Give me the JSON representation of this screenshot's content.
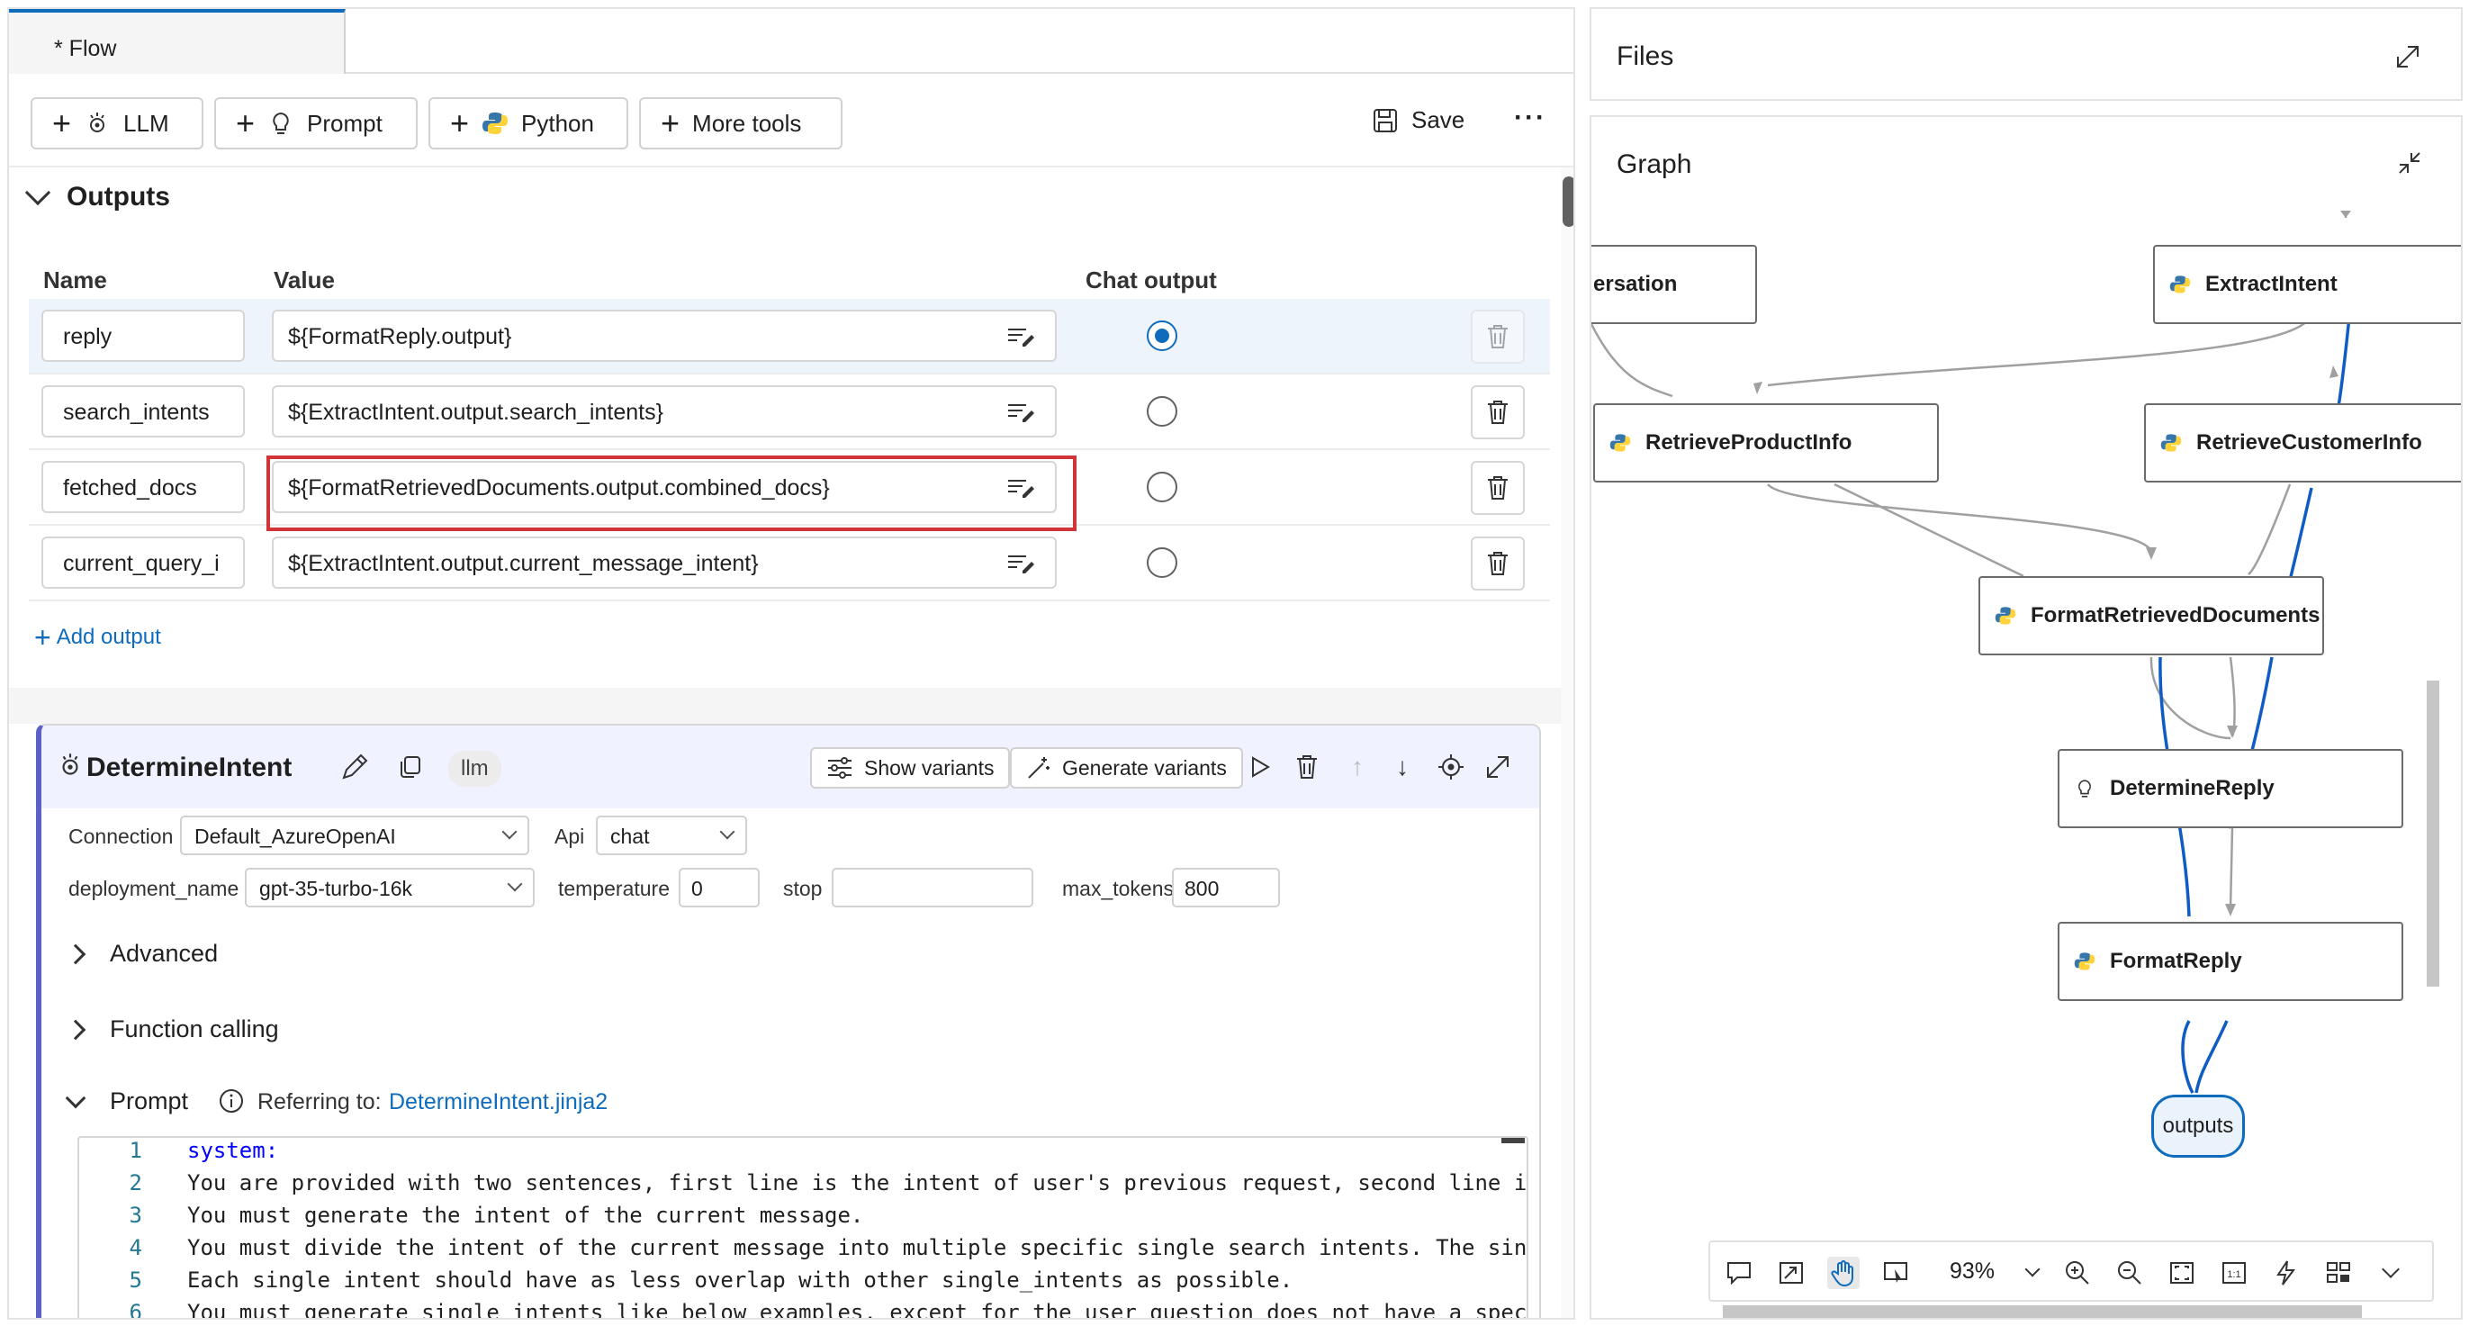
{
  "tab": {
    "label": "* Flow"
  },
  "toolbar": {
    "llm_label": "LLM",
    "prompt_label": "Prompt",
    "python_label": "Python",
    "more_tools_label": "More tools",
    "save_label": "Save",
    "more_label": "···"
  },
  "outputs": {
    "header": "Outputs",
    "columns": {
      "name": "Name",
      "value": "Value",
      "chat": "Chat output"
    },
    "rows": [
      {
        "name": "reply",
        "value": "${FormatReply.output}",
        "chat_output": true
      },
      {
        "name": "search_intents",
        "value": "${ExtractIntent.output.search_intents}",
        "chat_output": false
      },
      {
        "name": "fetched_docs",
        "value": "${FormatRetrievedDocuments.output.combined_docs}",
        "chat_output": false
      },
      {
        "name": "current_query_i",
        "value": "${ExtractIntent.output.current_message_intent}",
        "chat_output": false
      }
    ],
    "add_label": "Add output"
  },
  "node": {
    "title": "DetermineIntent",
    "type_chip": "llm",
    "show_variants": "Show variants",
    "generate_variants": "Generate variants",
    "connection_label": "Connection",
    "connection_value": "Default_AzureOpenAI",
    "api_label": "Api",
    "api_value": "chat",
    "deployment_label": "deployment_name",
    "deployment_value": "gpt-35-turbo-16k",
    "temperature_label": "temperature",
    "temperature_value": "0",
    "stop_label": "stop",
    "stop_value": "",
    "max_tokens_label": "max_tokens",
    "max_tokens_value": "800",
    "advanced_label": "Advanced",
    "function_calling_label": "Function calling",
    "prompt_label": "Prompt",
    "referring_label": "Referring to:",
    "referring_file": "DetermineIntent.jinja2",
    "code_lines": [
      {
        "n": "1",
        "text": "system:"
      },
      {
        "n": "2",
        "text": "You are provided with two sentences, first line is the intent of user's previous request, second line i"
      },
      {
        "n": "3",
        "text": "You must generate the intent of the current message."
      },
      {
        "n": "4",
        "text": "You must divide the intent of the current message into multiple specific single search intents. The sin"
      },
      {
        "n": "5",
        "text": "Each single intent should have as less overlap with other single_intents as possible."
      },
      {
        "n": "6",
        "text": "You must generate single intents like below examples, except for the user question does not have a spec"
      }
    ]
  },
  "files": {
    "title": "Files"
  },
  "graph": {
    "title": "Graph",
    "nodes": {
      "conversation": "ersation",
      "extract_intent": "ExtractIntent",
      "retrieve_product": "RetrieveProductInfo",
      "retrieve_customer": "RetrieveCustomerInfo",
      "format_docs": "FormatRetrievedDocuments",
      "determine_reply": "DetermineReply",
      "format_reply": "FormatReply",
      "outputs": "outputs"
    },
    "zoom": "93%"
  },
  "colors": {
    "accent": "#0f6cbd",
    "highlight": "#d13438",
    "edge_active": "#0f5cc4",
    "edge": "#a0a0a0"
  }
}
